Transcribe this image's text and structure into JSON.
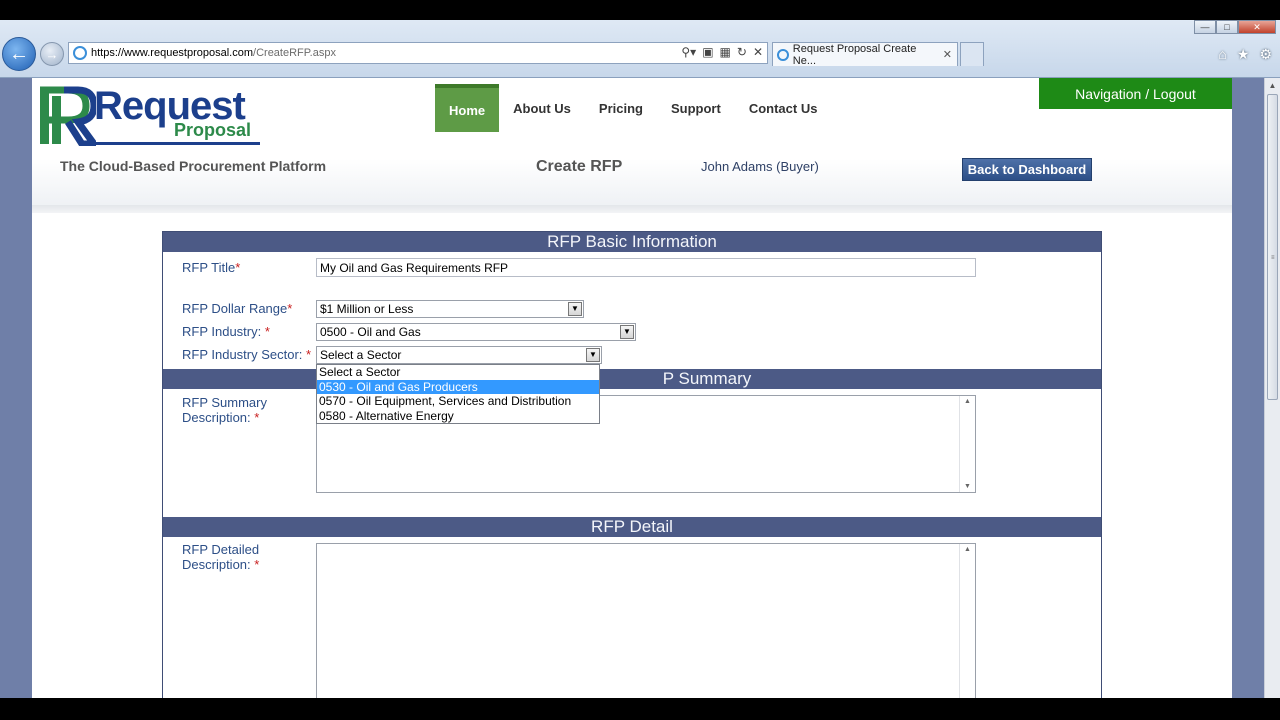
{
  "browser": {
    "url_host": "https://www.requestproposal.com",
    "url_path": "/CreateRFP.aspx",
    "tab_title": "Request Proposal Create Ne...",
    "window_controls": [
      "minimize-icon",
      "maximize-icon",
      "close-icon"
    ],
    "toolbar_icons": [
      "home-icon",
      "star-icon",
      "gear-icon"
    ]
  },
  "header": {
    "logo_main": "Request",
    "logo_sub": "Proposal",
    "tagline": "The Cloud-Based Procurement Platform",
    "menu": [
      "Home",
      "About Us",
      "Pricing",
      "Support",
      "Contact Us"
    ],
    "active_menu": "Home",
    "page_heading": "Create RFP",
    "user": "John Adams  (Buyer)",
    "nav_logout": "Navigation / Logout",
    "back_dashboard": "Back to Dashboard"
  },
  "colors": {
    "brand_blue": "#1c3f8c",
    "brand_green": "#2d8a4a",
    "section_bar": "#4c5a86",
    "nav_green": "#1e8a16"
  },
  "form": {
    "basic_section": "RFP Basic Information",
    "title_label": "RFP Title",
    "title_value": "My Oil and Gas Requirements RFP",
    "dollar_label": "RFP Dollar Range",
    "dollar_value": "$1 Million or Less",
    "industry_label": "RFP Industry: ",
    "industry_value": "0500 - Oil and Gas",
    "sector_label": "RFP Industry Sector: ",
    "sector_value": "Select a Sector",
    "sector_options": [
      "Select a Sector",
      "0530 - Oil and Gas Producers",
      "0570 - Oil Equipment, Services and Distribution",
      "0580 - Alternative Energy"
    ],
    "sector_highlighted": "0530 - Oil and Gas Producers",
    "summary_section": "RFP Summary",
    "summary_section_visible": "P Summary",
    "summary_label_1": "RFP Summary",
    "summary_label_2": "Description: ",
    "detail_section": "RFP Detail",
    "detail_label_1": "RFP Detailed",
    "detail_label_2": "Description: ",
    "required_mark": "*"
  }
}
